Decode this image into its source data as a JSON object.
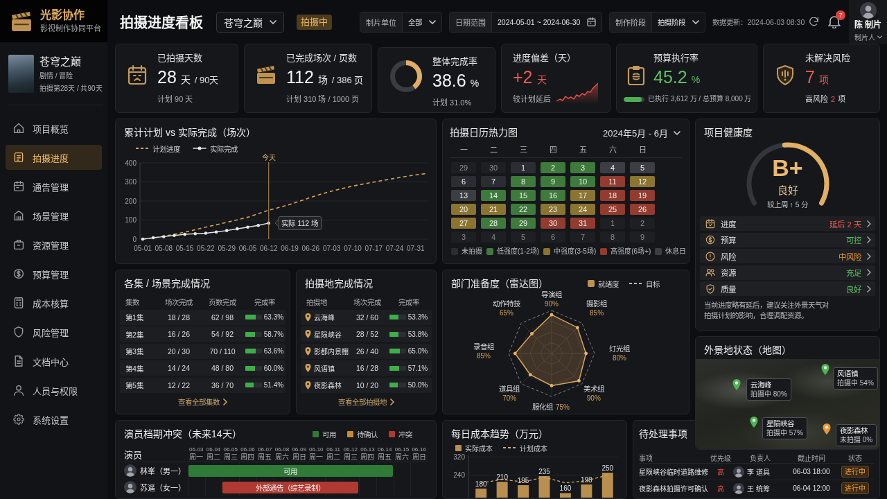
{
  "brand": {
    "name": "光影协作",
    "tagline": "影视制作协同平台"
  },
  "project": {
    "title": "苍穹之巅",
    "genre": "剧情 / 冒险",
    "progress": "拍摄第28天 / 共90天"
  },
  "nav": [
    {
      "label": "项目概览",
      "selected": false
    },
    {
      "label": "拍摄进度",
      "selected": true
    },
    {
      "label": "通告管理",
      "selected": false
    },
    {
      "label": "场景管理",
      "selected": false
    },
    {
      "label": "资源管理",
      "selected": false
    },
    {
      "label": "预算管理",
      "selected": false
    },
    {
      "label": "成本核算",
      "selected": false
    },
    {
      "label": "风险管理",
      "selected": false
    },
    {
      "label": "文档中心",
      "selected": false
    },
    {
      "label": "人员与权限",
      "selected": false
    },
    {
      "label": "系统设置",
      "selected": false
    }
  ],
  "header": {
    "title": "拍摄进度看板",
    "project_select": "苍穹之巅",
    "status_badge": "拍摄中",
    "filters": [
      {
        "kind": "select",
        "label": "制片单位",
        "value": "全部"
      },
      {
        "kind": "date",
        "label": "日期范围",
        "value": "2024-05-01 ~ 2024-06-30"
      },
      {
        "kind": "select",
        "label": "制作阶段",
        "value": "拍摄阶段"
      }
    ],
    "updated": "数据更新：2024-06-03 08:30",
    "notification_count": "7",
    "user": {
      "name": "陈 制片",
      "role": "制片人"
    }
  },
  "kpis": [
    {
      "kind": "count",
      "title": "已拍摄天数",
      "value": "28",
      "unit": "天",
      "suffix": "/ 90天",
      "note": "计划 90 天",
      "color": "#f3f3f3"
    },
    {
      "kind": "count",
      "title": "已完成场次 / 页数",
      "value": "112",
      "unit": "场",
      "suffix": "/ 386 页",
      "note": "计划 310 场 / 1000 页",
      "color": "#f3f3f3"
    },
    {
      "kind": "ring",
      "title": "整体完成率",
      "value": "38.6",
      "unit": "%",
      "note": "计划 31.0%",
      "color": "#f3f3f3",
      "level": 0.4
    },
    {
      "kind": "trend",
      "title": "进度偏差（天）",
      "value": "+2",
      "unit": "天",
      "note": "较计划延后",
      "color": "#f05b4f"
    },
    {
      "kind": "budget",
      "title": "预算执行率",
      "value": "45.2",
      "unit": "%",
      "note": "已执行 3,612 万 / 总预算 8,000 万",
      "color": "#5ec163",
      "level": 0.88
    },
    {
      "kind": "risk",
      "title": "未解决风险",
      "value": "7",
      "unit": "项",
      "note": "高风险",
      "note_value": "2",
      "note_unit": "项",
      "color": "#f05b4f"
    }
  ],
  "cumulative_chart": {
    "title": "累计计划 vs 实际完成（场次）",
    "chart_data": {
      "type": "line",
      "grid": true,
      "categories": [
        "05-01",
        null,
        "05-08",
        null,
        "05-15",
        null,
        "05-22",
        null,
        "05-29",
        null,
        "06-05",
        null,
        "06-12",
        null,
        "06-19",
        null,
        "06-26",
        null,
        "07-03",
        null,
        "07-10",
        null,
        "07-17",
        null,
        "07-24",
        null,
        "07-31",
        null
      ],
      "ylim": [
        0,
        400
      ],
      "yticks": [
        0,
        100,
        200,
        300,
        400
      ],
      "series": [
        {
          "name": "计划进度",
          "color": "#d9a55b",
          "line_style": "dashed",
          "values": [
            0,
            7,
            15,
            25,
            36,
            49,
            63,
            75,
            88,
            101,
            115,
            133,
            152,
            166,
            182,
            200,
            219,
            236,
            252,
            265,
            278,
            289,
            299,
            309,
            319,
            328,
            337,
            344
          ]
        },
        {
          "name": "实际完成",
          "color": "#e6e7e9",
          "line_style": "solid",
          "values": [
            0,
            7,
            13,
            19,
            25,
            28,
            31,
            37,
            45,
            54,
            63,
            72,
            84,
            null,
            null,
            null,
            null,
            null,
            null,
            null,
            null,
            null,
            null,
            null,
            null,
            null,
            null,
            null
          ]
        }
      ],
      "annotations": [
        "今天",
        "实际 112 场"
      ]
    }
  },
  "calendar": {
    "title": "拍摄日历热力图",
    "range": "2024年5月 - 6月",
    "weekdays": [
      "一",
      "二",
      "三",
      "四",
      "五",
      "六",
      "日"
    ],
    "days": [
      {
        "label": "29",
        "kind": "outside"
      },
      {
        "label": "30",
        "kind": "outside"
      },
      {
        "label": "1",
        "kind": "none"
      },
      {
        "label": "2",
        "kind": "low"
      },
      {
        "label": "3",
        "kind": "low"
      },
      {
        "label": "4",
        "kind": "rest"
      },
      {
        "label": "5",
        "kind": "rest"
      },
      {
        "label": "6",
        "kind": "none"
      },
      {
        "label": "7",
        "kind": "none"
      },
      {
        "label": "8",
        "kind": "low"
      },
      {
        "label": "9",
        "kind": "low"
      },
      {
        "label": "10",
        "kind": "low"
      },
      {
        "label": "11",
        "kind": "high"
      },
      {
        "label": "12",
        "kind": "mid"
      },
      {
        "label": "13",
        "kind": "rest"
      },
      {
        "label": "14",
        "kind": "low"
      },
      {
        "label": "15",
        "kind": "low"
      },
      {
        "label": "16",
        "kind": "low"
      },
      {
        "label": "17",
        "kind": "mid"
      },
      {
        "label": "18",
        "kind": "high"
      },
      {
        "label": "19",
        "kind": "high"
      },
      {
        "label": "20",
        "kind": "mid"
      },
      {
        "label": "21",
        "kind": "mid"
      },
      {
        "label": "22",
        "kind": "low"
      },
      {
        "label": "23",
        "kind": "mid"
      },
      {
        "label": "24",
        "kind": "mid"
      },
      {
        "label": "25",
        "kind": "high"
      },
      {
        "label": "26",
        "kind": "high"
      },
      {
        "label": "27",
        "kind": "mid"
      },
      {
        "label": "28",
        "kind": "low"
      },
      {
        "label": "29",
        "kind": "low"
      },
      {
        "label": "30",
        "kind": "high"
      },
      {
        "label": "31",
        "kind": "high"
      },
      {
        "label": "1",
        "kind": "outside"
      },
      {
        "label": "2",
        "kind": "outside"
      },
      {
        "label": "3",
        "kind": "outside"
      },
      {
        "label": "4",
        "kind": "outside"
      },
      {
        "label": "5",
        "kind": "outside"
      },
      {
        "label": "6",
        "kind": "outside"
      },
      {
        "label": "7",
        "kind": "outside"
      },
      {
        "label": "8",
        "kind": "outside"
      },
      {
        "label": "9",
        "kind": "outside"
      }
    ],
    "legend": [
      {
        "kind": "none",
        "label": "未拍摄"
      },
      {
        "kind": "low",
        "label": "低强度(1-2场)"
      },
      {
        "kind": "mid",
        "label": "中强度(3-5场)"
      },
      {
        "kind": "high",
        "label": "高强度(6场+)"
      },
      {
        "kind": "rest",
        "label": "休息日"
      }
    ]
  },
  "health": {
    "title": "项目健康度",
    "grade": "B+",
    "rating": "良好",
    "change": "较上周 ↑ 5 分",
    "level": 0.52,
    "items": [
      {
        "label": "进度",
        "status": "延后 2 天",
        "kind": "bad"
      },
      {
        "label": "预算",
        "status": "可控",
        "kind": "good"
      },
      {
        "label": "风险",
        "status": "中风险",
        "kind": "warn"
      },
      {
        "label": "资源",
        "status": "充足",
        "kind": "good"
      },
      {
        "label": "质量",
        "status": "良好",
        "kind": "good"
      }
    ],
    "note": "当前进度略有延后，建议关注外景天气对拍摄计划的影响，合理调配资源。"
  },
  "episodes": {
    "title": "各集 / 场景完成情况",
    "columns": [
      "集数",
      "场次完成",
      "页数完成",
      "完成率"
    ],
    "rows": [
      {
        "name": "第1集",
        "scenes": "18 / 28",
        "pages": "62 / 98",
        "rate": "63.3%",
        "level": 0.633
      },
      {
        "name": "第2集",
        "scenes": "16 / 26",
        "pages": "54 / 92",
        "rate": "58.7%",
        "level": 0.587
      },
      {
        "name": "第3集",
        "scenes": "20 / 30",
        "pages": "70 / 110",
        "rate": "63.6%",
        "level": 0.636
      },
      {
        "name": "第4集",
        "scenes": "14 / 24",
        "pages": "48 / 80",
        "rate": "60.0%",
        "level": 0.6
      },
      {
        "name": "第5集",
        "scenes": "12 / 22",
        "pages": "36 / 70",
        "rate": "51.4%",
        "level": 0.514
      }
    ],
    "link": "查看全部集数"
  },
  "locations": {
    "title": "拍摄地完成情况",
    "columns": [
      "拍摄地",
      "场次完成",
      "完成率"
    ],
    "rows": [
      {
        "name": "云海峰",
        "scenes": "32 / 60",
        "rate": "53.3%",
        "level": 0.533
      },
      {
        "name": "星陨峡谷",
        "scenes": "28 / 52",
        "rate": "53.8%",
        "level": 0.538
      },
      {
        "name": "影都内景棚",
        "scenes": "26 / 40",
        "rate": "65.0%",
        "level": 0.65
      },
      {
        "name": "风语镇",
        "scenes": "16 / 28",
        "rate": "57.1%",
        "level": 0.571
      },
      {
        "name": "夜影森林",
        "scenes": "10 / 20",
        "rate": "50.0%",
        "level": 0.5
      }
    ],
    "link": "查看全部拍摄地"
  },
  "readiness": {
    "title": "部门准备度（雷达图）",
    "legend": [
      {
        "kind": "actual",
        "label": "就绪度"
      },
      {
        "kind": "target",
        "label": "目标"
      }
    ],
    "departments": [
      {
        "name": "导演组",
        "reading": "90%"
      },
      {
        "name": "摄影组",
        "reading": "85%"
      },
      {
        "name": "灯光组",
        "reading": "80%"
      },
      {
        "name": "美术组",
        "reading": "90%"
      },
      {
        "name": "服化组",
        "reading": "75%"
      },
      {
        "name": "道具组",
        "reading": "70%"
      },
      {
        "name": "录音组",
        "reading": "85%"
      },
      {
        "name": "动作特技",
        "reading": "65%"
      }
    ]
  },
  "map": {
    "title": "外景地状态（地图）",
    "sites": [
      {
        "name": "云海峰",
        "status": "拍摄中 80%",
        "color": "#4cb552"
      },
      {
        "name": "风语镇",
        "status": "拍摄中 54%",
        "color": "#4cb552"
      },
      {
        "name": "星陨峡谷",
        "status": "拍摄中 57%",
        "color": "#4cb552"
      },
      {
        "name": "夜影森林",
        "status": "未拍摄 0%",
        "color": "#ec9638"
      }
    ]
  },
  "schedule": {
    "title": "演员档期冲突（未来14天）",
    "legend": [
      {
        "kind": "available",
        "label": "可用"
      },
      {
        "kind": "pending",
        "label": "待确认"
      },
      {
        "kind": "conflict",
        "label": "冲突"
      }
    ],
    "name_header": "演员",
    "dates": [
      {
        "date": "06-03",
        "weekday": "周一"
      },
      {
        "date": "06-04",
        "weekday": "周二"
      },
      {
        "date": "06-05",
        "weekday": "周三"
      },
      {
        "date": "06-06",
        "weekday": "周四"
      },
      {
        "date": "06-07",
        "weekday": "周五"
      },
      {
        "date": "06-08",
        "weekday": "周六"
      },
      {
        "date": "06-09",
        "weekday": "周日"
      },
      {
        "date": "06-10",
        "weekday": "周一"
      },
      {
        "date": "06-11",
        "weekday": "周二"
      },
      {
        "date": "06-12",
        "weekday": "周三"
      },
      {
        "date": "06-13",
        "weekday": "周四"
      },
      {
        "date": "06-14",
        "weekday": "周五"
      },
      {
        "date": "06-15",
        "weekday": "周六"
      },
      {
        "date": "06-16",
        "weekday": "周日"
      }
    ],
    "actors": [
      {
        "name": "林峯（男一）",
        "bar_label": "可用",
        "days": [
          {
            "kind": "available"
          },
          {
            "kind": "available"
          },
          {
            "kind": "available"
          },
          {
            "kind": "available"
          },
          {
            "kind": "available"
          },
          {
            "kind": "available"
          },
          {
            "kind": "available"
          },
          {
            "kind": "available"
          },
          {
            "kind": "available"
          },
          {
            "kind": "available"
          },
          {
            "kind": "available"
          },
          {
            "kind": "available"
          },
          {
            "kind": "none"
          },
          {
            "kind": "none"
          }
        ]
      },
      {
        "name": "苏遥（女一）",
        "bar_label": "外部通告（综艺录制）",
        "days": [
          {
            "kind": "none"
          },
          {
            "kind": "none"
          },
          {
            "kind": "conflict"
          },
          {
            "kind": "conflict"
          },
          {
            "kind": "conflict"
          },
          {
            "kind": "conflict"
          },
          {
            "kind": "conflict"
          },
          {
            "kind": "conflict"
          },
          {
            "kind": "conflict"
          },
          {
            "kind": "conflict"
          },
          {
            "kind": "none"
          },
          {
            "kind": "none"
          },
          {
            "kind": "none"
          },
          {
            "kind": "none"
          }
        ]
      }
    ]
  },
  "cost": {
    "title": "每日成本趋势（万元）",
    "chart_data": {
      "type": "bar",
      "grid": true,
      "ylim": [
        140,
        330
      ],
      "yticks": [
        240,
        320
      ],
      "series": [
        {
          "name": "实际成本",
          "type": "bar",
          "color": "#b88f4e",
          "values": [
            180,
            210,
            195,
            235,
            160,
            198,
            250
          ],
          "value_labels": [
            "180",
            "210",
            "195",
            "235",
            "160",
            "198",
            "250"
          ]
        },
        {
          "name": "计划成本",
          "type": "line",
          "line_style": "dashed",
          "color": "#d7a95e",
          "values": [
            205,
            220,
            210,
            230,
            205,
            215,
            240
          ]
        }
      ]
    }
  },
  "todos": {
    "title": "待处理事项",
    "columns": [
      "事项",
      "优先级",
      "负责人",
      "截止时间",
      "状态"
    ],
    "rows": [
      {
        "item": "星陨峡谷临时道路维修",
        "priority": "高",
        "high_priority": true,
        "owner": "李 道具",
        "deadline": "06-03 18:00",
        "status": "进行中",
        "in_progress": true
      },
      {
        "item": "夜影森林拍摄许可确认",
        "priority": "高",
        "high_priority": true,
        "owner": "王 统筹",
        "deadline": "06-04 12:00",
        "status": "进行中",
        "in_progress": true
      }
    ]
  }
}
